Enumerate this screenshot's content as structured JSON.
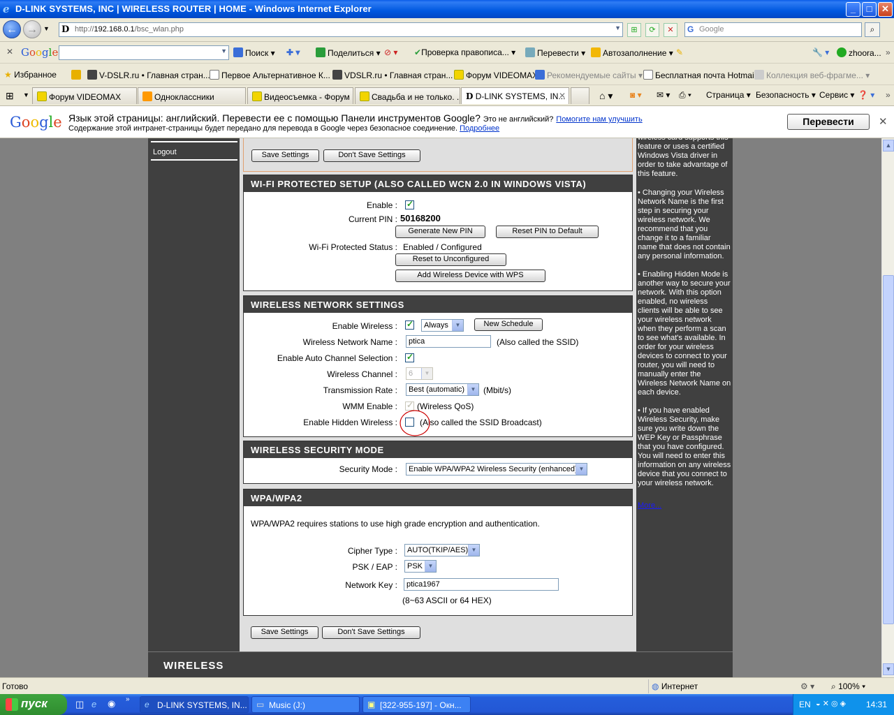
{
  "window": {
    "title": "D-LINK SYSTEMS, INC | WIRELESS ROUTER | HOME - Windows Internet Explorer"
  },
  "address": {
    "url_scheme": "http://",
    "url_host": "192.168.0.1",
    "url_path": "/bsc_wlan.php",
    "search_placeholder": "Google"
  },
  "google_toolbar": {
    "logo": [
      "G",
      "o",
      "o",
      "g",
      "l",
      "e"
    ],
    "search_label": "Поиск",
    "share_label": "Поделиться",
    "spellcheck_label": "Проверка правописа...",
    "translate_label": "Перевести",
    "autofill_label": "Автозаполнение",
    "account_label": "zhoora..."
  },
  "favorites": {
    "label": "Избранное",
    "items": [
      "V-DSLR.ru • Главная стран...",
      "Первое Альтернативное К...",
      "VDSLR.ru • Главная стран...",
      "Форум VIDEOMAX",
      "Рекомендуемые сайты",
      "Бесплатная почта Hotmail",
      "Коллекция веб-фрагме..."
    ]
  },
  "tabs": [
    "Форум VIDEOMAX",
    "Одноклассники",
    "Видеосъемка - Форум ...",
    "Свадьба и не только. ...",
    "D-LINK SYSTEMS, IN..."
  ],
  "commands": {
    "page": "Страница",
    "security": "Безопасность",
    "service": "Сервис"
  },
  "translate_bar": {
    "logo": "Google",
    "line1": "Язык этой страницы: английский. Перевести ее с помощью Панели инструментов Google?",
    "not_english": "Это не английский?",
    "help_link": "Помогите нам улучшить",
    "line2": "Содержание этой интранет-страницы будет передано для перевода в Google через безопасное соединение.",
    "more_link": "Подробнее",
    "button": "Перевести"
  },
  "router": {
    "logout": "Logout",
    "save_settings": "Save Settings",
    "dont_save_settings": "Don't Save Settings",
    "wps": {
      "header": "WI-FI PROTECTED SETUP (ALSO CALLED WCN 2.0 IN WINDOWS VISTA)",
      "enable_label": "Enable :",
      "enable_checked": true,
      "current_pin_label": "Current PIN :",
      "current_pin": "50168200",
      "generate_pin": "Generate New PIN",
      "reset_pin": "Reset PIN to Default",
      "status_label": "Wi-Fi Protected Status :",
      "status_value": "Enabled / Configured",
      "reset_unconfigured": "Reset to Unconfigured",
      "add_device": "Add Wireless Device with WPS"
    },
    "wireless": {
      "header": "WIRELESS NETWORK SETTINGS",
      "enable_label": "Enable Wireless :",
      "enable_checked": true,
      "schedule_value": "Always",
      "new_schedule": "New Schedule",
      "ssid_label": "Wireless Network Name :",
      "ssid_value": "ptica",
      "ssid_note": "(Also called the SSID)",
      "auto_channel_label": "Enable Auto Channel Selection :",
      "auto_channel_checked": true,
      "channel_label": "Wireless Channel :",
      "channel_value": "6",
      "rate_label": "Transmission Rate :",
      "rate_value": "Best (automatic)",
      "rate_unit": "(Mbit/s)",
      "wmm_label": "WMM Enable :",
      "wmm_checked": true,
      "wmm_note": "(Wireless QoS)",
      "hidden_label": "Enable Hidden Wireless :",
      "hidden_checked": false,
      "hidden_note": "(Also called the SSID Broadcast)"
    },
    "security": {
      "header": "WIRELESS SECURITY MODE",
      "mode_label": "Security Mode :",
      "mode_value": "Enable WPA/WPA2 Wireless Security (enhanced)"
    },
    "wpa": {
      "header": "WPA/WPA2",
      "desc": "WPA/WPA2 requires stations to use high grade encryption and authentication.",
      "cipher_label": "Cipher Type :",
      "cipher_value": "AUTO(TKIP/AES)",
      "psk_label": "PSK / EAP :",
      "psk_value": "PSK",
      "key_label": "Network Key :",
      "key_value": "ptica1967",
      "key_hint": "(8~63 ASCII or 64 HEX)"
    },
    "help": {
      "p0": "wireless card supports this feature or uses a certified Windows Vista driver in order to take advantage of this feature.",
      "p1": "• Changing your Wireless Network Name is the first step in securing your wireless network. We recommend that you change it to a familiar name that does not contain any personal information.",
      "p2": "• Enabling Hidden Mode is another way to secure your network. With this option enabled, no wireless clients will be able to see your wireless network when they perform a scan to see what's available. In order for your wireless devices to connect to your router, you will need to manually enter the Wireless Network Name on each device.",
      "p3": "• If you have enabled Wireless Security, make sure you write down the WEP Key or Passphrase that you have configured. You will need to enter this information on any wireless device that you connect to your wireless network.",
      "more": "More..."
    },
    "footer_brand": "WIRELESS"
  },
  "statusbar": {
    "left": "Готово",
    "zone": "Интернет",
    "zoom": "100%"
  },
  "taskbar": {
    "start": "пуск",
    "tasks": [
      "D-LINK SYSTEMS, IN...",
      "Music (J:)",
      "[322-955-197] - Окн..."
    ],
    "lang": "EN",
    "clock": "14:31"
  },
  "colors": {
    "xp_blue": "#0058e0",
    "dlink_dark": "#404040",
    "annotation_red": "#cc0000"
  }
}
